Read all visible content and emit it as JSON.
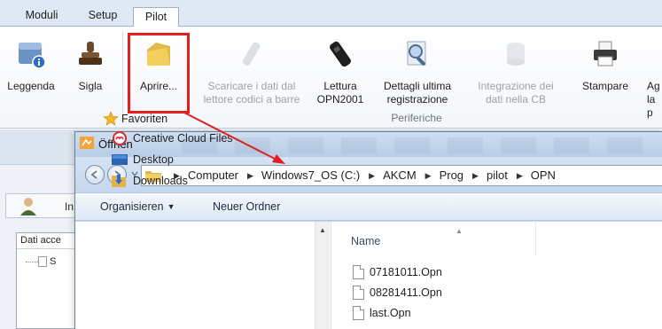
{
  "ribbon": {
    "tabs": [
      {
        "label": "Moduli"
      },
      {
        "label": "Setup"
      },
      {
        "label": "Pilot"
      }
    ],
    "active_tab": "Pilot",
    "buttons": [
      {
        "label": "Leggenda",
        "icon": "legend-info-icon",
        "enabled": true
      },
      {
        "label": "Sigla",
        "icon": "stamp-icon",
        "enabled": true
      },
      {
        "label": "Aprire...",
        "icon": "open-folder-icon",
        "enabled": true,
        "highlighted": true
      },
      {
        "label": "Scaricare i dati dal\nlettore codici a barre",
        "icon": "barcode-reader-icon",
        "enabled": false
      },
      {
        "label": "Lettura\nOPN2001",
        "icon": "opn2001-scanner-icon",
        "enabled": true
      },
      {
        "label": "Dettagli ultima\nregistrazione",
        "icon": "magnifier-icon",
        "enabled": true
      },
      {
        "label": "Integrazione dei\ndati nella CB",
        "icon": "database-icon",
        "enabled": false
      },
      {
        "label": "Stampare",
        "icon": "printer-icon",
        "enabled": true
      },
      {
        "label": "Ag\nla p",
        "icon": "partial-icon",
        "enabled": true
      }
    ],
    "group_label": "Periferiche",
    "highlight_color": "#e0201f"
  },
  "background_app": {
    "tab_label": "In",
    "list_header": "Dati acce",
    "list_row": "S"
  },
  "dialog": {
    "title": "Öffnen",
    "breadcrumb": [
      "Computer",
      "Windows7_OS (C:)",
      "AKCM",
      "Prog",
      "pilot",
      "OPN"
    ],
    "commands": {
      "organize": "Organisieren",
      "new_folder": "Neuer Ordner"
    },
    "nav_pane": [
      {
        "label": "Favoriten",
        "icon": "star-icon"
      },
      {
        "label": "Creative Cloud Files",
        "icon": "creative-cloud-icon"
      },
      {
        "label": "Desktop",
        "icon": "desktop-icon"
      },
      {
        "label": "Downloads",
        "icon": "downloads-folder-icon"
      }
    ],
    "column_header": "Name",
    "files": [
      {
        "name": "07181011.Opn"
      },
      {
        "name": "08281411.Opn"
      },
      {
        "name": "last.Opn"
      }
    ]
  }
}
